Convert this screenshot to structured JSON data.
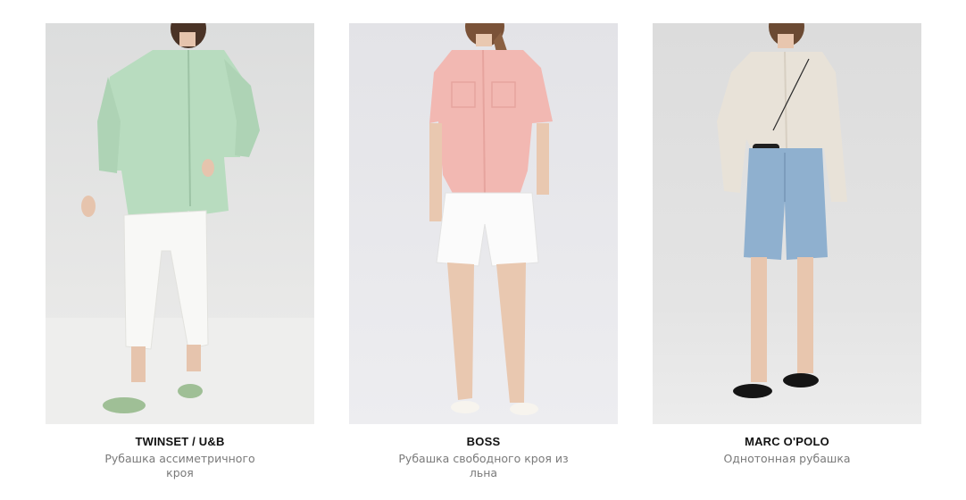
{
  "products": [
    {
      "brand": "TWINSET / U&B",
      "title": "Рубашка ассиметричного кроя",
      "image_icon": "product-photo-green-asymmetric-shirt"
    },
    {
      "brand": "BOSS",
      "title": "Рубашка свободного кроя из льна",
      "image_icon": "product-photo-pink-linen-shirt"
    },
    {
      "brand": "MARC O'POLO",
      "title": "Однотонная рубашка",
      "image_icon": "product-photo-beige-shirt"
    }
  ],
  "colors": {
    "shirt_green": "#b8dcbf",
    "shirt_pink": "#f2b8b2",
    "shirt_beige": "#e8e2d8",
    "denim": "#8fb0cf",
    "backdrop": "#e9e9ec"
  }
}
